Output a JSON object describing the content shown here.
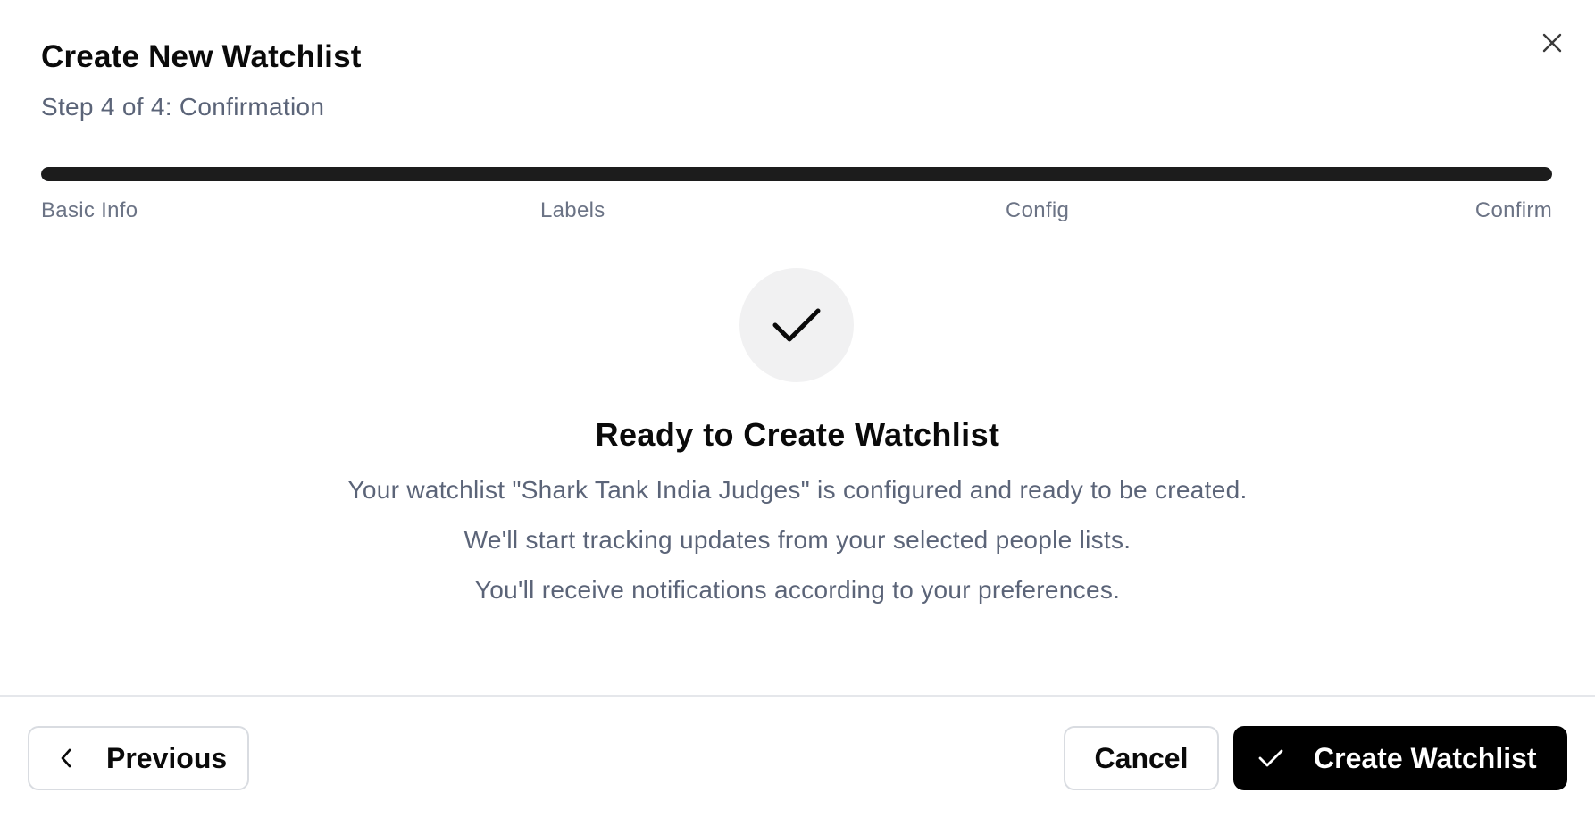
{
  "dialog": {
    "title": "Create New Watchlist",
    "subtitle": "Step 4 of 4: Confirmation",
    "close_icon": "close-icon"
  },
  "progress": {
    "fraction": 1.0,
    "color": "#1c1c1c",
    "steps": [
      "Basic Info",
      "Labels",
      "Config",
      "Confirm"
    ]
  },
  "confirmation": {
    "icon": "check-icon",
    "heading": "Ready to Create Watchlist",
    "lines": [
      "Your watchlist \"Shark Tank India Judges\" is configured and ready to be created.",
      "We'll start tracking updates from your selected people lists.",
      "You'll receive notifications according to your preferences."
    ]
  },
  "footer": {
    "previous_label": "Previous",
    "previous_icon": "chevron-left-icon",
    "cancel_label": "Cancel",
    "create_label": "Create Watchlist",
    "create_icon": "check-icon"
  },
  "colors": {
    "primary": "#000000",
    "muted_text": "#5b6478",
    "border": "#d9dce1"
  }
}
